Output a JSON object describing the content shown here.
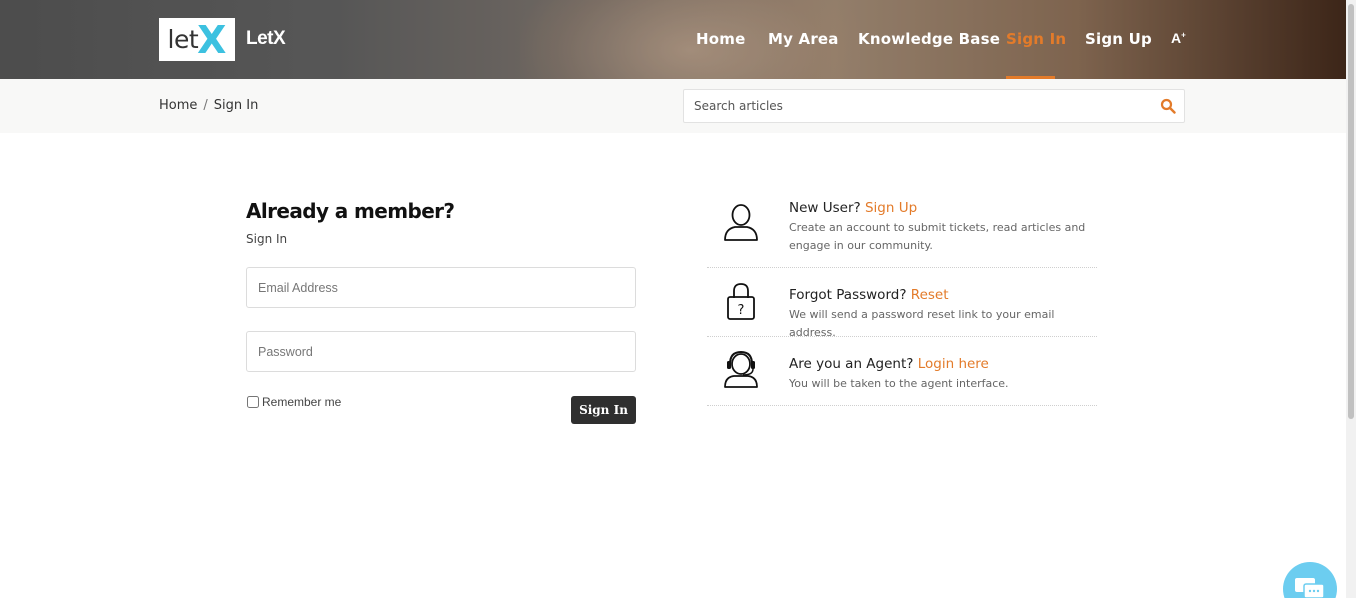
{
  "header": {
    "logo_text_let": "let",
    "logo_text_x": "X",
    "brand": "LetX",
    "nav": [
      {
        "label": "Home"
      },
      {
        "label": "My Area"
      },
      {
        "label": "Knowledge Base"
      },
      {
        "label": "Sign In",
        "active": true
      },
      {
        "label": "Sign Up"
      }
    ],
    "a11y_label": "A",
    "accent_color": "#e37b2a"
  },
  "breadcrumb": {
    "items": [
      "Home",
      "Sign In"
    ],
    "separator": "/"
  },
  "search": {
    "placeholder": "Search articles",
    "value": "",
    "icon": "search-icon"
  },
  "signin": {
    "title": "Already a member?",
    "subtitle": "Sign In",
    "email_placeholder": "Email Address",
    "password_placeholder": "Password",
    "remember_label": "Remember me",
    "remember_checked": false,
    "button_label": "Sign In"
  },
  "info": [
    {
      "icon": "user-icon",
      "title": "New User?",
      "link": "Sign Up",
      "description": "Create an account to submit tickets, read articles and engage in our community."
    },
    {
      "icon": "lock-icon",
      "title": "Forgot Password?",
      "link": "Reset",
      "description": "We will send a password reset link to your email address."
    },
    {
      "icon": "headset-agent-icon",
      "title": "Are you an Agent?",
      "link": "Login here",
      "description": "You will be taken to the agent interface."
    }
  ],
  "chat": {
    "icon": "chat-icon",
    "color": "#6ccdf0"
  }
}
